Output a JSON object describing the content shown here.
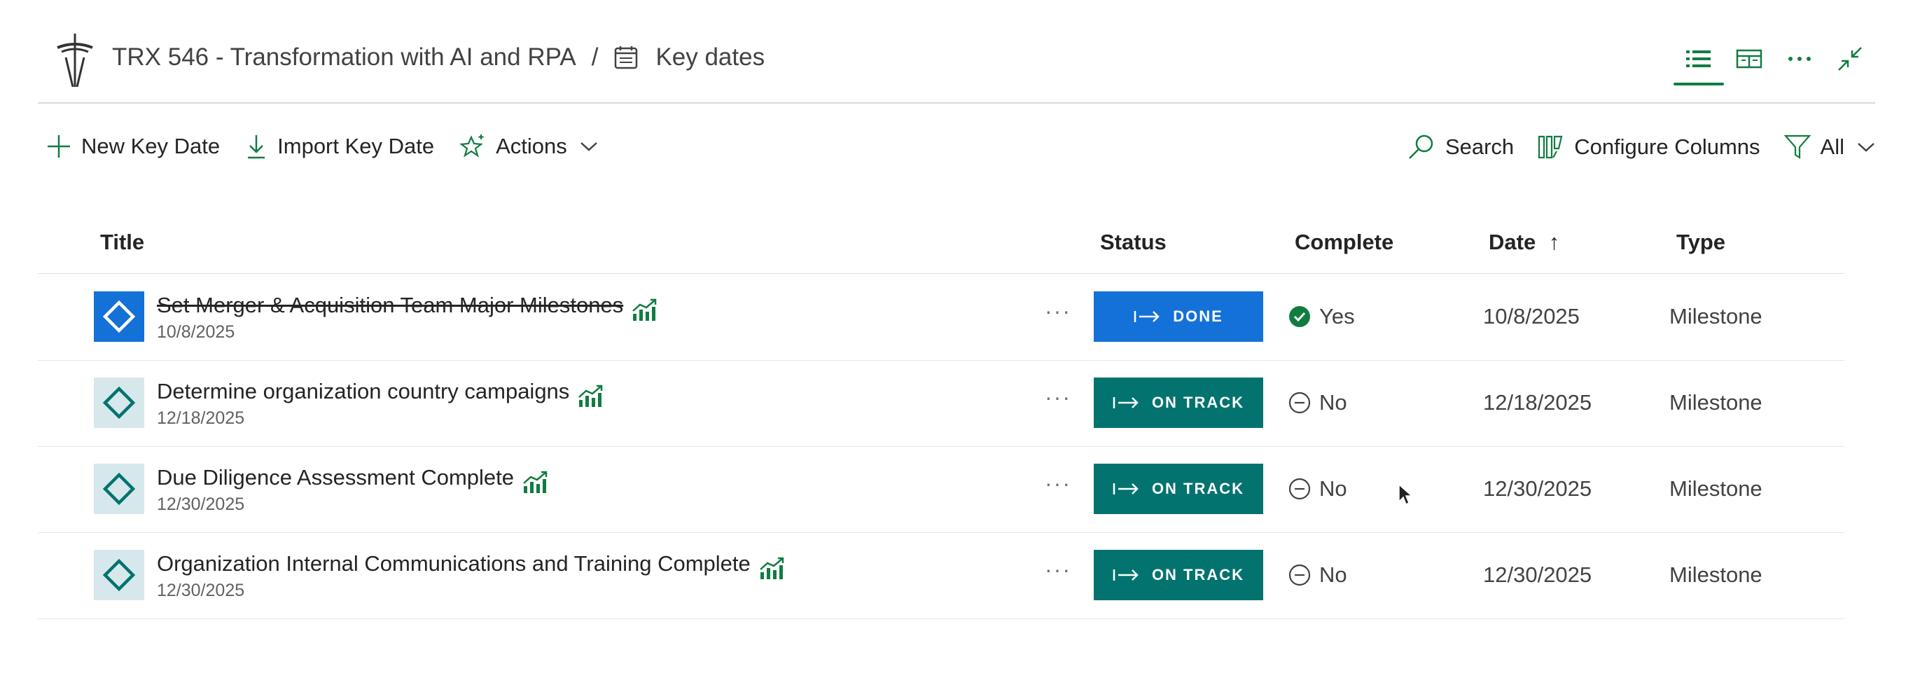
{
  "header": {
    "project": "TRX 546 - Transformation with AI and RPA",
    "separator": "/",
    "page": "Key dates"
  },
  "toolbar": {
    "new_key_date": "New Key Date",
    "import_key_date": "Import Key Date",
    "actions": "Actions",
    "search": "Search",
    "configure_columns": "Configure Columns",
    "filter": "All"
  },
  "columns": {
    "title": "Title",
    "status": "Status",
    "complete": "Complete",
    "date": "Date",
    "date_sort": "↑",
    "type": "Type"
  },
  "rows": [
    {
      "title": "Set Merger & Acquisition Team Major Milestones",
      "subdate": "10/8/2025",
      "more": "···",
      "status": "DONE",
      "complete": "Yes",
      "date": "10/8/2025",
      "type": "Milestone"
    },
    {
      "title": "Determine organization country campaigns",
      "subdate": "12/18/2025",
      "more": "···",
      "status": "ON TRACK",
      "complete": "No",
      "date": "12/18/2025",
      "type": "Milestone"
    },
    {
      "title": "Due Diligence Assessment Complete",
      "subdate": "12/30/2025",
      "more": "···",
      "status": "ON TRACK",
      "complete": "No",
      "date": "12/30/2025",
      "type": "Milestone"
    },
    {
      "title": "Organization Internal Communications and Training Complete",
      "subdate": "12/30/2025",
      "more": "···",
      "status": "ON TRACK",
      "complete": "No",
      "date": "12/30/2025",
      "type": "Milestone"
    }
  ],
  "colors": {
    "accent_green": "#107c41",
    "done_blue": "#1471d8",
    "on_track_teal": "#02736f",
    "milestone_icon_bg": "#d6e8ec"
  },
  "icons": {
    "logo": "space-needle-logo",
    "page": "calendar-icon",
    "list_view": "list-view-icon",
    "board_view": "board-view-icon",
    "more": "more-icon",
    "collapse": "collapse-icon",
    "new": "plus-icon",
    "import": "download-icon",
    "actions": "sparkle-star-icon",
    "search": "search-icon",
    "columns": "columns-icon",
    "filter": "filter-icon",
    "trend": "trend-chart-icon",
    "milestone": "diamond-icon"
  }
}
